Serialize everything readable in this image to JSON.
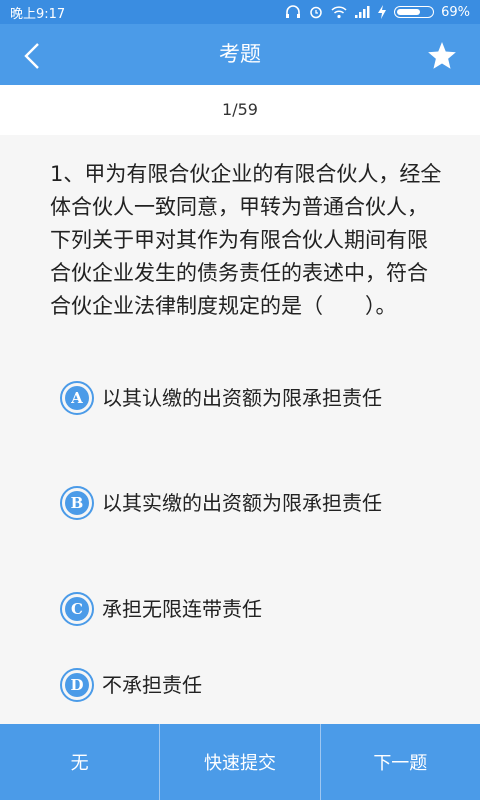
{
  "status_bar": {
    "time": "晚上9:17",
    "battery_level": 0.69,
    "battery_text": "69%"
  },
  "app_bar": {
    "title": "考题",
    "back_icon": "chevron-left-icon",
    "star_icon": "star-icon"
  },
  "counter": "1/59",
  "question": {
    "text": "1、甲为有限合伙企业的有限合伙人，经全体合伙人一致同意，甲转为普通合伙人，下列关于甲对其作为有限合伙人期间有限合伙企业发生的债务责任的表述中，符合合伙企业法律制度规定的是（　　）。"
  },
  "options": [
    {
      "letter": "A",
      "text": "以其认缴的出资额为限承担责任"
    },
    {
      "letter": "B",
      "text": "以其实缴的出资额为限承担责任"
    },
    {
      "letter": "C",
      "text": "承担无限连带责任"
    },
    {
      "letter": "D",
      "text": "不承担责任"
    }
  ],
  "bottom_bar": {
    "left": "无",
    "middle": "快速提交",
    "right": "下一题"
  },
  "colors": {
    "primary": "#4b9be8",
    "status": "#3a8de1"
  }
}
